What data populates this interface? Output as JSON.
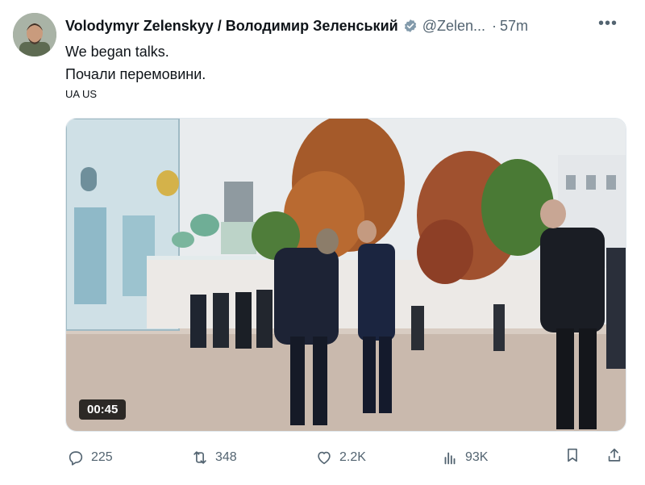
{
  "author": {
    "name": "Volodymyr Zelenskyy / Володимир Зеленський",
    "handle": "@Zelen...",
    "separator": "·",
    "time": "57m"
  },
  "more_menu": "•••",
  "tweet": {
    "line1": "We began talks.",
    "line2": "Почали перемовини.",
    "language_tag": "UA US"
  },
  "video": {
    "duration": "00:45"
  },
  "actions": {
    "replies": "225",
    "reposts": "348",
    "likes": "2.2K",
    "views": "93K"
  },
  "colors": {
    "text": "#0f1419",
    "secondary": "#536471",
    "verified": "#829aab"
  }
}
